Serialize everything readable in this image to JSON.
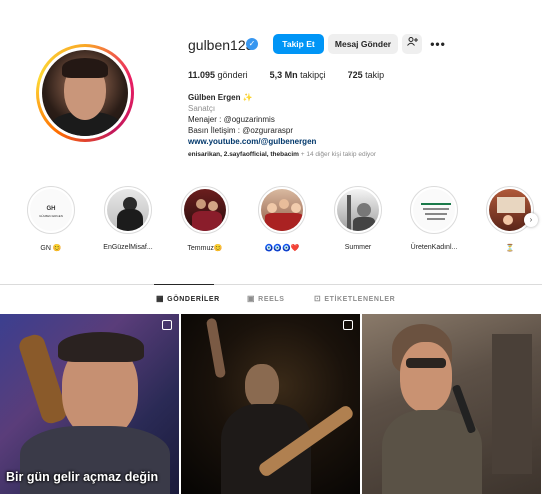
{
  "profile": {
    "username": "gulben123",
    "follow_label": "Takip Et",
    "message_label": "Mesaj Gönder",
    "add_icon": "person-add-icon",
    "more_icon": "more-horizontal-icon"
  },
  "stats": {
    "posts_count": "11.095",
    "posts_label": "gönderi",
    "followers_count": "5,3 Mn",
    "followers_label": "takipçi",
    "following_count": "725",
    "following_label": "takip"
  },
  "bio": {
    "name": "Gülben Ergen ✨",
    "category": "Sanatçı",
    "line1": "Menajer : @oguzarinmis",
    "line2": "Basın İletişim : @ozguraraspr",
    "link": "www.youtube.com/@gulbenergen"
  },
  "followed_by": {
    "names": "enisarikan, 2.sayfaofficial, thebacim",
    "rest": " + 14 diğer kişi takip ediyor"
  },
  "highlights": [
    {
      "label": "GN 😊"
    },
    {
      "label": "EnGüzelMisaf..."
    },
    {
      "label": "Temmuz😊"
    },
    {
      "label": "🧿🧿🧿❤️"
    },
    {
      "label": "Summer"
    },
    {
      "label": "ÜretenKadınl..."
    },
    {
      "label": "⏳"
    }
  ],
  "highlight_gn": {
    "title": "GH",
    "subtitle": "GÜLBEN ERGEN"
  },
  "tabs": {
    "posts": "GÖNDERİLER",
    "reels": "REELS",
    "tagged": "ETİKETLENENLER"
  },
  "posts": [
    {
      "caption": "Bir gün gelir açmaz değin"
    },
    {
      "caption": ""
    },
    {
      "caption": ""
    }
  ],
  "colors": {
    "accent": "#0095f6",
    "verified": "#3897f0"
  }
}
